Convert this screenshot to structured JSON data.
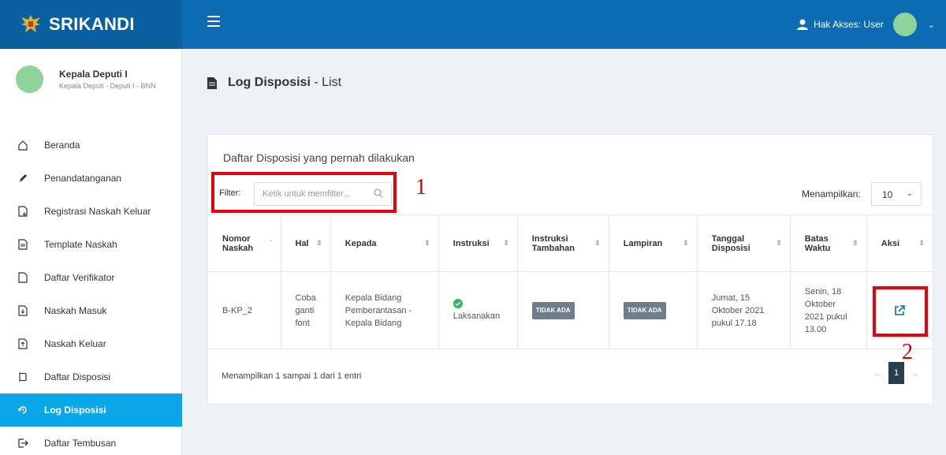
{
  "app": {
    "brand": "SRIKANDI"
  },
  "topbar": {
    "access_label": "Hak Akses: User"
  },
  "profile": {
    "name": "Kepala Deputi I",
    "role": "Kepala Deputi - Deputi I - BNN"
  },
  "sidebar": {
    "items": [
      {
        "label": "Beranda",
        "icon": "home-icon"
      },
      {
        "label": "Penandatanganan",
        "icon": "pen-icon"
      },
      {
        "label": "Registrasi Naskah Keluar",
        "icon": "doc-register-icon"
      },
      {
        "label": "Template Naskah",
        "icon": "template-icon"
      },
      {
        "label": "Daftar Verifikator",
        "icon": "verifier-icon"
      },
      {
        "label": "Naskah Masuk",
        "icon": "inbox-doc-icon"
      },
      {
        "label": "Naskah Keluar",
        "icon": "outbox-doc-icon"
      },
      {
        "label": "Daftar Disposisi",
        "icon": "disposition-icon"
      },
      {
        "label": "Log Disposisi",
        "icon": "history-icon",
        "active": true
      },
      {
        "label": "Daftar Tembusan",
        "icon": "exit-icon"
      }
    ]
  },
  "page": {
    "title_bold": "Log Disposisi",
    "title_rest": " - List"
  },
  "card": {
    "title": "Daftar Disposisi yang pernah dilakukan",
    "filter_label": "Filter:",
    "filter_placeholder": "Ketik untuk memfilter...",
    "show_label": "Menampilkan:",
    "show_value": "10"
  },
  "table": {
    "headers": [
      "Nomor Naskah",
      "Hal",
      "Kepada",
      "Instruksi",
      "Instruksi Tambahan",
      "Lampiran",
      "Tanggal Disposisi",
      "Batas Waktu",
      "Aksi"
    ],
    "rows": [
      {
        "nomor": "B-KP_2",
        "hal": "Coba ganti font",
        "kepada": "Kepala Bidang Pemberantasan - Kepala Bidang",
        "instruksi": "Laksanakan",
        "instruksi_tambahan": "TIDAK ADA",
        "lampiran": "TIDAK ADA",
        "tanggal": "Jumat, 15 Oktober 2021 pukul 17.18",
        "batas": "Senin, 18 Oktober 2021 pukul 13.00"
      }
    ]
  },
  "footer": {
    "entries": "Menampilkan 1 sampai 1 dari 1 entri",
    "page": "1",
    "prev": "←",
    "next": "→"
  },
  "annotations": {
    "one": "1",
    "two": "2"
  },
  "colors": {
    "topbar": "#0c6cb3",
    "active": "#0aa6e8",
    "annotation": "#e8000a"
  }
}
